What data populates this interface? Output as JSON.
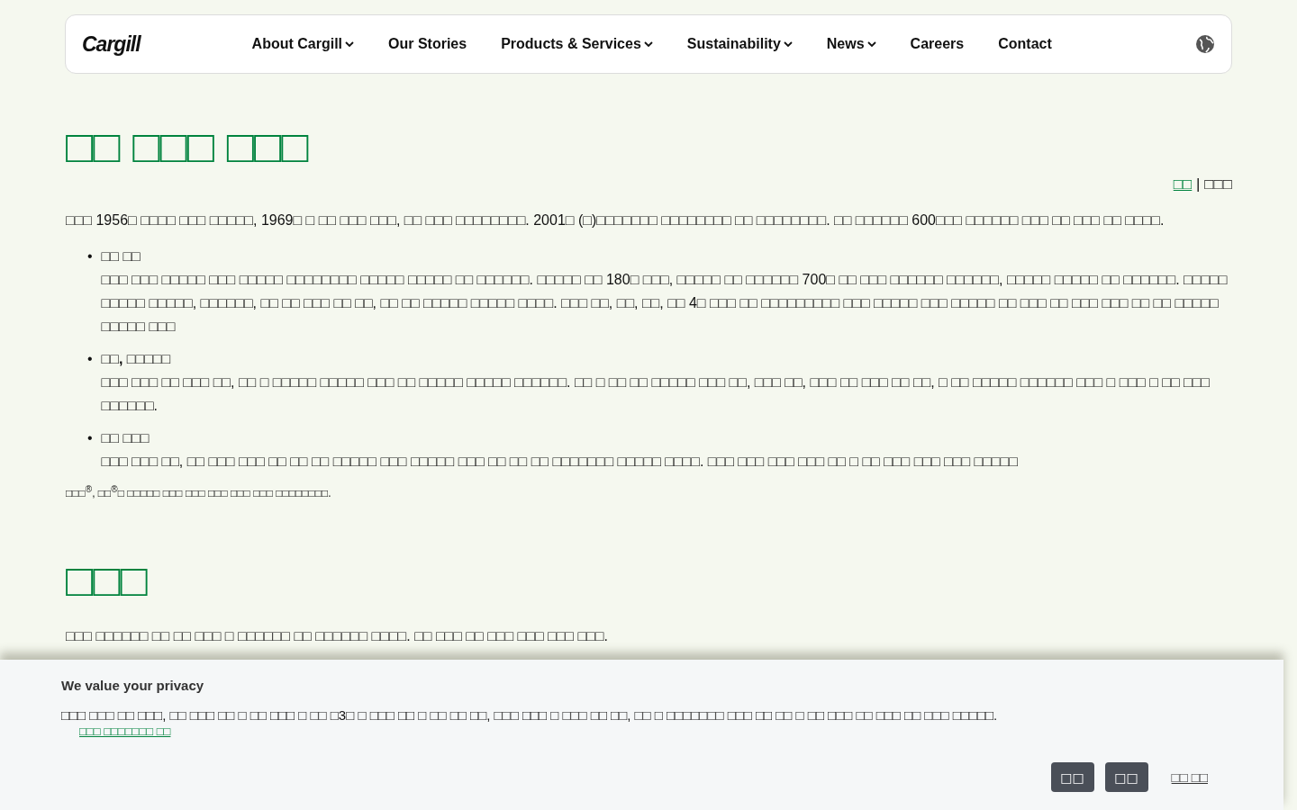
{
  "header": {
    "logo": "Cargill",
    "nav": [
      {
        "label": "About Cargill",
        "dropdown": true
      },
      {
        "label": "Our Stories",
        "dropdown": false
      },
      {
        "label": "Products & Services",
        "dropdown": true
      },
      {
        "label": "Sustainability",
        "dropdown": true
      },
      {
        "label": "News",
        "dropdown": true
      },
      {
        "label": "Careers",
        "dropdown": false
      },
      {
        "label": "Contact",
        "dropdown": false
      }
    ]
  },
  "article": {
    "title": "□□ □□□ □□□",
    "breadcrumb": {
      "link": "□□",
      "separator": "|",
      "current": "□□□"
    },
    "intro": "□□□ 1956□ □□□□ □□□ □□□□□, 1969□ □ □□ □□□ □□□, □□ □□□ □□□□□□□□. 2001□ (□)□□□□□□□ □□□□□□□□ □□ □□□□□□□□. □□ □□□□□□ 600□□□ □□□□□□ □□□ □□ □□□ □□ □□□□.",
    "items": [
      {
        "marker": "•",
        "title": "□□ □□",
        "text": "□□□ □□□ □□□□□ □□□ □□□□□ □□□□□□□□ □□□□□ □□□□□ □□ □□□□□□. □□□□□ □□ 180□ □□□, □□□□□ □□ □□□□□□ 700□ □□ □□□ □□□□□□ □□□□□□, □□□□□ □□□□□ □□ □□□□□□. □□□□□ □□□□□ □□□□□, □□□□□□, □□ □□ □□□ □□ □□, □□ □□ □□□□□ □□□□□ □□□□. □□□ □□, □□, □□, □□ 4□ □□□ □□ □□□□□□□□□ □□□ □□□□□ □□□ □□□□□ □□ □□□ □□ □□□ □□□ □□ □□ □□□□□ □□□□□ □□□"
      },
      {
        "marker": "•",
        "title": "□□, □□□□□",
        "text": "□□□ □□□ □□ □□□ □□, □□ □ □□□□□ □□□□□ □□□ □□ □□□□□ □□□□□ □□□□□□. □□ □ □□ □□ □□□□□ □□□ □□, □□□ □□, □□□ □□ □□□ □□ □□, □ □□ □□□□□ □□□□□□ □□□ □ □□□ □ □□ □□□ □□□□□□."
      },
      {
        "marker": "•",
        "title": "□□ □□□",
        "text": "□□□ □□□ □□, □□ □□□ □□□ □□ □□ □□ □□□□□ □□□ □□□□□ □□□ □□ □□ □□ □□□□□□□ □□□□□ □□□□. □□□ □□□ □□□ □□□ □□ □ □□ □□□ □□□ □□□ □□□□□"
      }
    ],
    "footnote": "□□□$^{®}$, □□$^{®}$□ □□□□□ □□□ □□□ □□□ □□□ □□□ □□□□□□□□."
  },
  "section2": {
    "title": "□□□",
    "text": "□□□ □□□□□□ □□ □□ □□□ □ □□□□□□ □□ □□□□□□ □□□□. □□ □□□ □□ □□□ □□□ □□□ □□□."
  },
  "cookie_banner": {
    "title": "We value your privacy",
    "text": "□□□ □□□ □□ □□□, □□ □□□ □□ □ □□ □□□ □ □□ □3□ □ □□□ □□ □ □□ □□ □□, □□□ □□□ □ □□□ □□ □□, □□ □ □□□□□□□ □□□ □□ □□ □ □□ □□□ □□ □□□ □□ □□□ □□□□□.",
    "policy_link": "□□□ □□□□□□□ □□",
    "buttons": [
      {
        "label": "□□",
        "kind": "button"
      },
      {
        "label": "□□",
        "kind": "button"
      },
      {
        "label": "□□ □□",
        "kind": "link"
      }
    ]
  }
}
